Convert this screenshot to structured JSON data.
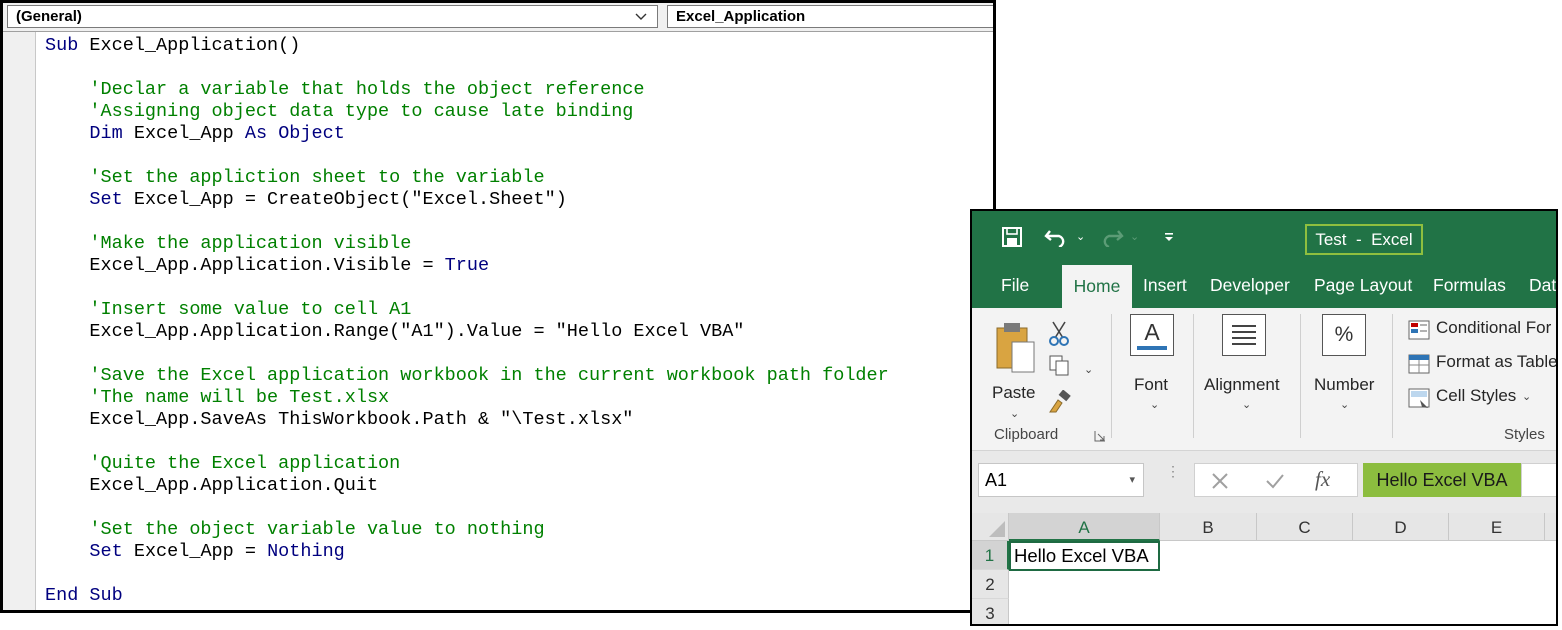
{
  "vbe": {
    "object_combo": "(General)",
    "procedure_combo": "Excel_Application",
    "code_lines": [
      [
        {
          "t": "Sub",
          "c": "kw"
        },
        {
          "t": " Excel_Application()"
        }
      ],
      [],
      [
        {
          "t": "    'Declar a variable that holds the object reference",
          "c": "cm"
        }
      ],
      [
        {
          "t": "    'Assigning object data type to cause late binding",
          "c": "cm"
        }
      ],
      [
        {
          "t": "    "
        },
        {
          "t": "Dim",
          "c": "kw"
        },
        {
          "t": " Excel_App "
        },
        {
          "t": "As",
          "c": "kw"
        },
        {
          "t": " "
        },
        {
          "t": "Object",
          "c": "kw"
        }
      ],
      [],
      [
        {
          "t": "    'Set the appliction sheet to the variable",
          "c": "cm"
        }
      ],
      [
        {
          "t": "    "
        },
        {
          "t": "Set",
          "c": "kw"
        },
        {
          "t": " Excel_App = CreateObject(\"Excel.Sheet\")"
        }
      ],
      [],
      [
        {
          "t": "    'Make the application visible",
          "c": "cm"
        }
      ],
      [
        {
          "t": "    Excel_App.Application.Visible = "
        },
        {
          "t": "True",
          "c": "kw"
        }
      ],
      [],
      [
        {
          "t": "    'Insert some value to cell A1",
          "c": "cm"
        }
      ],
      [
        {
          "t": "    Excel_App.Application.Range(\"A1\").Value = \"Hello Excel VBA\""
        }
      ],
      [],
      [
        {
          "t": "    'Save the Excel application workbook in the current workbook path folder",
          "c": "cm"
        }
      ],
      [
        {
          "t": "    'The name will be Test.xlsx",
          "c": "cm"
        }
      ],
      [
        {
          "t": "    Excel_App.SaveAs ThisWorkbook.Path & \"\\Test.xlsx\""
        }
      ],
      [],
      [
        {
          "t": "    'Quite the Excel application",
          "c": "cm"
        }
      ],
      [
        {
          "t": "    Excel_App.Application.Quit"
        }
      ],
      [],
      [
        {
          "t": "    'Set the object variable value to nothing",
          "c": "cm"
        }
      ],
      [
        {
          "t": "    "
        },
        {
          "t": "Set",
          "c": "kw"
        },
        {
          "t": " Excel_App = "
        },
        {
          "t": "Nothing",
          "c": "kw"
        }
      ],
      [],
      [
        {
          "t": "End Sub",
          "c": "kw"
        }
      ]
    ]
  },
  "excel": {
    "title": "Test  -  Excel",
    "tabs": [
      "File",
      "Home",
      "Insert",
      "Developer",
      "Page Layout",
      "Formulas",
      "Dat"
    ],
    "active_tab": "Home",
    "ribbon": {
      "paste": "Paste",
      "clipboard": "Clipboard",
      "font": "Font",
      "alignment": "Alignment",
      "number": "Number",
      "number_symbol": "%",
      "font_symbol": "A",
      "conditional": "Conditional For",
      "format_table": "Format as Table",
      "cell_styles": "Cell Styles",
      "styles": "Styles"
    },
    "name_box": "A1",
    "fx_label": "fx",
    "formula_value": "Hello Excel VBA",
    "columns": [
      "A",
      "B",
      "C",
      "D",
      "E"
    ],
    "rows": [
      "1",
      "2",
      "3"
    ],
    "cell_a1": "Hello Excel VBA",
    "colors": {
      "excel_green": "#217346",
      "title_highlight": "#8fbf3f",
      "formula_highlight": "#8cbd3f",
      "vba_keyword": "#00007f",
      "vba_comment": "#008000"
    }
  }
}
